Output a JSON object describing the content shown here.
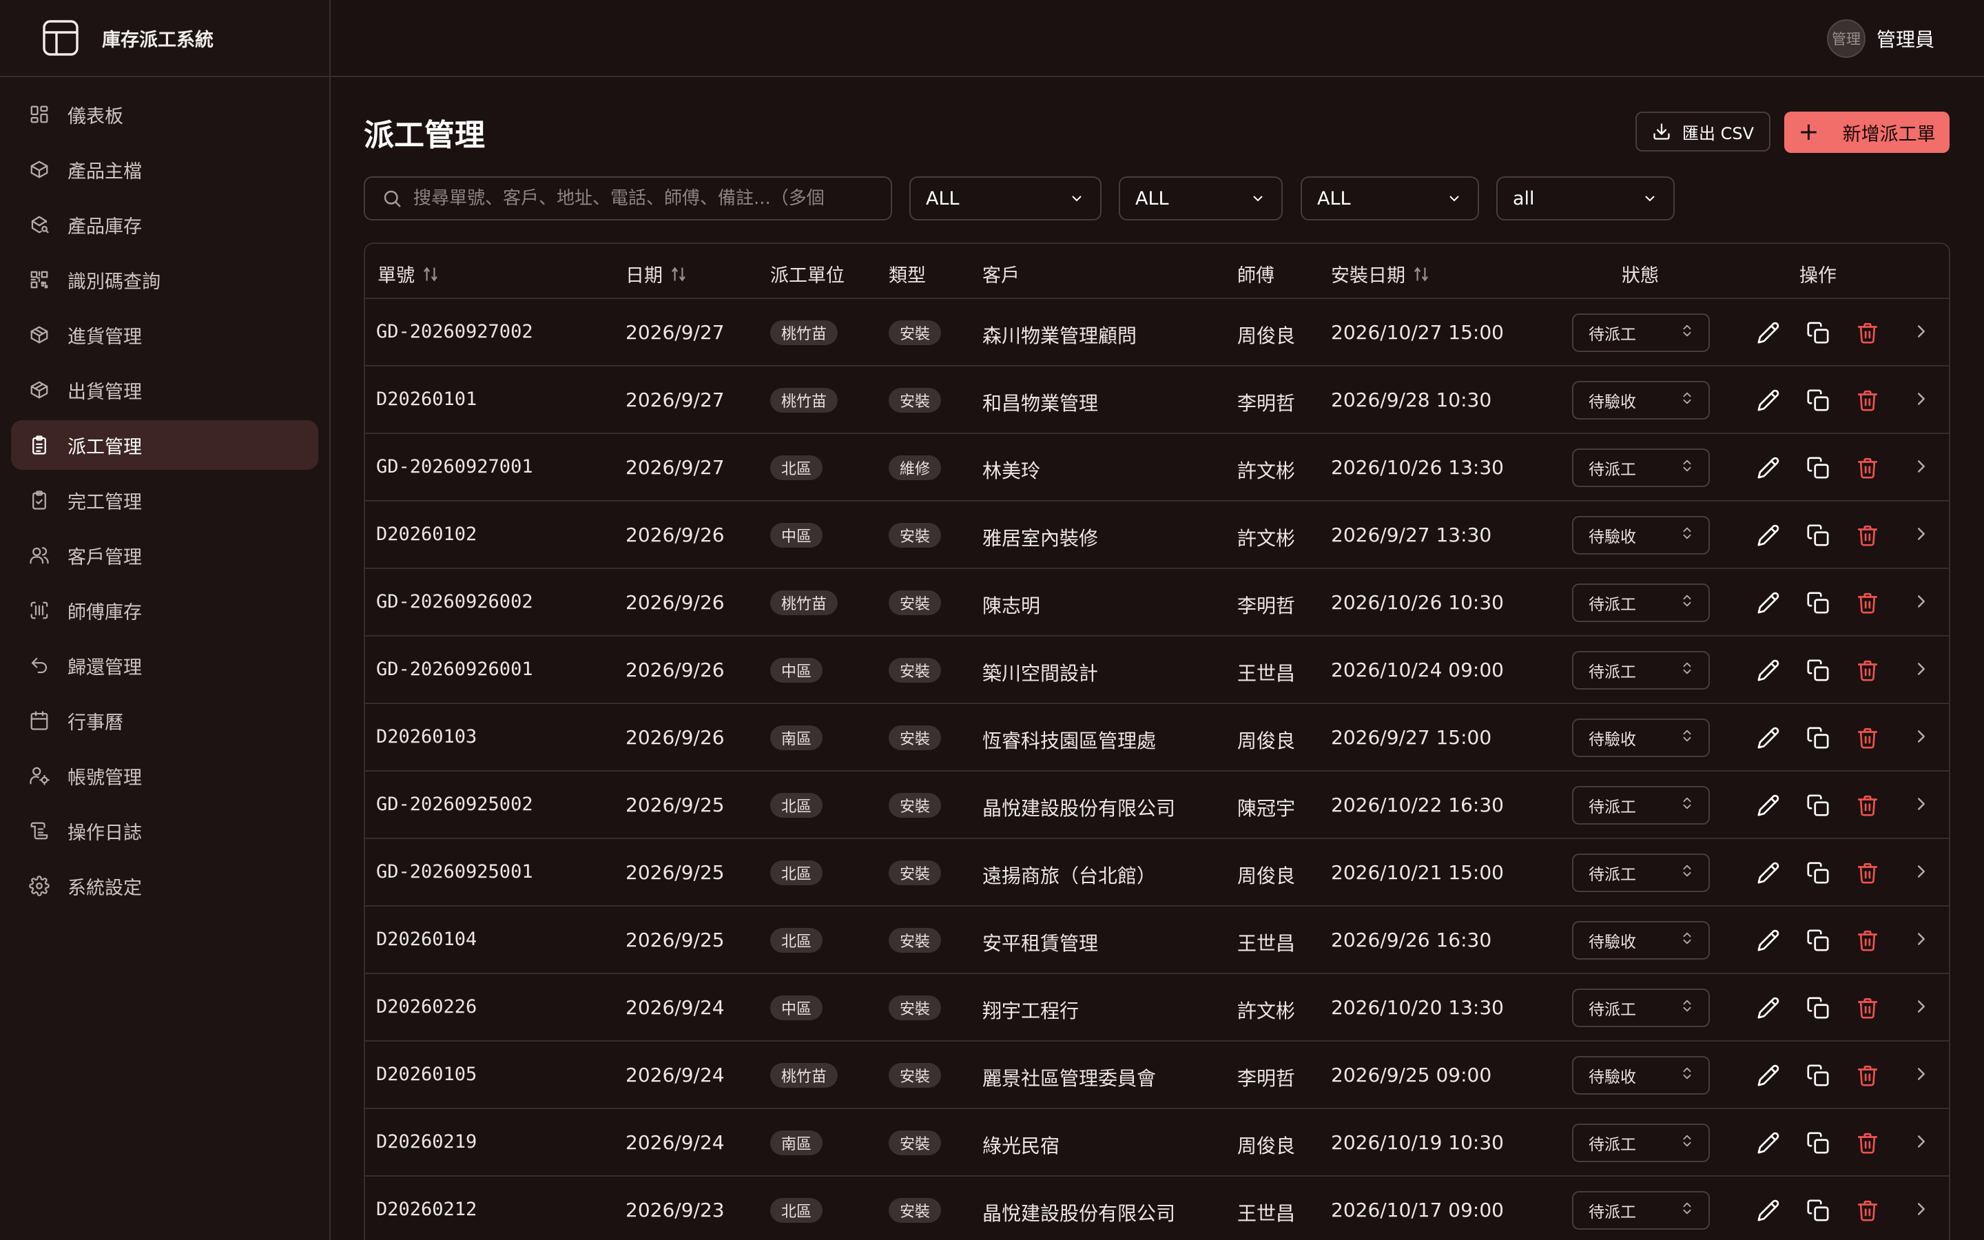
{
  "app": {
    "title": "庫存派工系統"
  },
  "user": {
    "avatar_text": "管理",
    "name": "管理員"
  },
  "sidebar": {
    "items": [
      {
        "label": "儀表板",
        "icon": "dashboard-icon",
        "active": false
      },
      {
        "label": "產品主檔",
        "icon": "package-icon",
        "active": false
      },
      {
        "label": "產品庫存",
        "icon": "package-search-icon",
        "active": false
      },
      {
        "label": "識別碼查詢",
        "icon": "qr-code-icon",
        "active": false
      },
      {
        "label": "進貨管理",
        "icon": "package-in-icon",
        "active": false
      },
      {
        "label": "出貨管理",
        "icon": "package-out-icon",
        "active": false
      },
      {
        "label": "派工管理",
        "icon": "clipboard-list-icon",
        "active": true
      },
      {
        "label": "完工管理",
        "icon": "clipboard-check-icon",
        "active": false
      },
      {
        "label": "客戶管理",
        "icon": "users-icon",
        "active": false
      },
      {
        "label": "師傅庫存",
        "icon": "scan-barcode-icon",
        "active": false
      },
      {
        "label": "歸還管理",
        "icon": "undo-icon",
        "active": false
      },
      {
        "label": "行事曆",
        "icon": "calendar-icon",
        "active": false
      },
      {
        "label": "帳號管理",
        "icon": "user-cog-icon",
        "active": false
      },
      {
        "label": "操作日誌",
        "icon": "log-icon",
        "active": false
      },
      {
        "label": "系統設定",
        "icon": "settings-icon",
        "active": false
      }
    ]
  },
  "page": {
    "title": "派工管理",
    "export_label": "匯出 CSV",
    "new_label": "新增派工單",
    "search_placeholder": "搜尋單號、客戶、地址、電話、師傅、備註...（多個",
    "filters": [
      "ALL",
      "ALL",
      "ALL",
      "all"
    ]
  },
  "table": {
    "headers": {
      "order_no": "單號",
      "date": "日期",
      "unit": "派工單位",
      "type": "類型",
      "customer": "客戶",
      "technician": "師傅",
      "install_date": "安裝日期",
      "status": "狀態",
      "actions": "操作"
    },
    "rows": [
      {
        "order_no": "GD-20260927002",
        "date": "2026/9/27",
        "unit": "桃竹苗",
        "type": "安裝",
        "customer": "森川物業管理顧問",
        "technician": "周俊良",
        "install_date": "2026/10/27 15:00",
        "status": "待派工"
      },
      {
        "order_no": "D20260101",
        "date": "2026/9/27",
        "unit": "桃竹苗",
        "type": "安裝",
        "customer": "和昌物業管理",
        "technician": "李明哲",
        "install_date": "2026/9/28 10:30",
        "status": "待驗收"
      },
      {
        "order_no": "GD-20260927001",
        "date": "2026/9/27",
        "unit": "北區",
        "type": "維修",
        "customer": "林美玲",
        "technician": "許文彬",
        "install_date": "2026/10/26 13:30",
        "status": "待派工"
      },
      {
        "order_no": "D20260102",
        "date": "2026/9/26",
        "unit": "中區",
        "type": "安裝",
        "customer": "雅居室內裝修",
        "technician": "許文彬",
        "install_date": "2026/9/27 13:30",
        "status": "待驗收"
      },
      {
        "order_no": "GD-20260926002",
        "date": "2026/9/26",
        "unit": "桃竹苗",
        "type": "安裝",
        "customer": "陳志明",
        "technician": "李明哲",
        "install_date": "2026/10/26 10:30",
        "status": "待派工"
      },
      {
        "order_no": "GD-20260926001",
        "date": "2026/9/26",
        "unit": "中區",
        "type": "安裝",
        "customer": "築川空間設計",
        "technician": "王世昌",
        "install_date": "2026/10/24 09:00",
        "status": "待派工"
      },
      {
        "order_no": "D20260103",
        "date": "2026/9/26",
        "unit": "南區",
        "type": "安裝",
        "customer": "恆睿科技園區管理處",
        "technician": "周俊良",
        "install_date": "2026/9/27 15:00",
        "status": "待驗收"
      },
      {
        "order_no": "GD-20260925002",
        "date": "2026/9/25",
        "unit": "北區",
        "type": "安裝",
        "customer": "晶悅建設股份有限公司",
        "technician": "陳冠宇",
        "install_date": "2026/10/22 16:30",
        "status": "待派工"
      },
      {
        "order_no": "GD-20260925001",
        "date": "2026/9/25",
        "unit": "北區",
        "type": "安裝",
        "customer": "遠揚商旅（台北館）",
        "technician": "周俊良",
        "install_date": "2026/10/21 15:00",
        "status": "待派工"
      },
      {
        "order_no": "D20260104",
        "date": "2026/9/25",
        "unit": "北區",
        "type": "安裝",
        "customer": "安平租賃管理",
        "technician": "王世昌",
        "install_date": "2026/9/26 16:30",
        "status": "待驗收"
      },
      {
        "order_no": "D20260226",
        "date": "2026/9/24",
        "unit": "中區",
        "type": "安裝",
        "customer": "翔宇工程行",
        "technician": "許文彬",
        "install_date": "2026/10/20 13:30",
        "status": "待派工"
      },
      {
        "order_no": "D20260105",
        "date": "2026/9/24",
        "unit": "桃竹苗",
        "type": "安裝",
        "customer": "麗景社區管理委員會",
        "technician": "李明哲",
        "install_date": "2026/9/25 09:00",
        "status": "待驗收"
      },
      {
        "order_no": "D20260219",
        "date": "2026/9/24",
        "unit": "南區",
        "type": "安裝",
        "customer": "綠光民宿",
        "technician": "周俊良",
        "install_date": "2026/10/19 10:30",
        "status": "待派工"
      },
      {
        "order_no": "D20260212",
        "date": "2026/9/23",
        "unit": "北區",
        "type": "安裝",
        "customer": "晶悅建設股份有限公司",
        "technician": "王世昌",
        "install_date": "2026/10/17 09:00",
        "status": "待派工"
      }
    ]
  },
  "colors": {
    "accent": "#f16e6a",
    "delete": "#f0514f",
    "background": "#1a1110",
    "sidebar_active": "#3c2523"
  }
}
